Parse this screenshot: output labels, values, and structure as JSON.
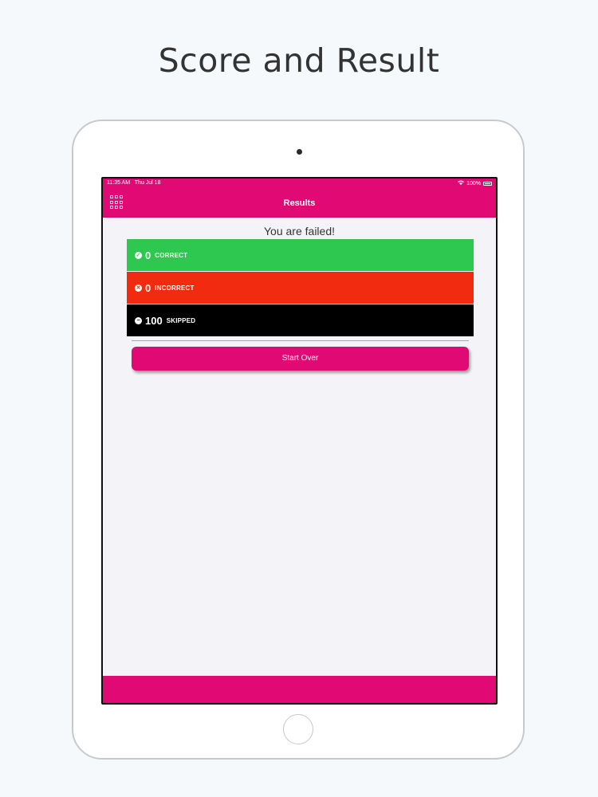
{
  "promo": {
    "title": "Score and Result"
  },
  "status_bar": {
    "time": "11:35 AM",
    "date": "Thu Jul 18",
    "battery": "100%"
  },
  "nav": {
    "title": "Results",
    "menu_icon": "grid-icon"
  },
  "result": {
    "message": "You are failed!"
  },
  "stats": {
    "correct": {
      "count": "0",
      "label": "CORRECT",
      "icon": "check-circle-icon",
      "color": "#2ec851"
    },
    "incorrect": {
      "count": "0",
      "label": "INCORRECT",
      "icon": "x-circle-icon",
      "color": "#f12b10"
    },
    "skipped": {
      "count": "100",
      "label": "SKIPPED",
      "icon": "minus-circle-icon",
      "color": "#000000"
    }
  },
  "actions": {
    "start_over": "Start Over"
  },
  "colors": {
    "accent": "#e10a74",
    "background": "#f4f3f7"
  }
}
